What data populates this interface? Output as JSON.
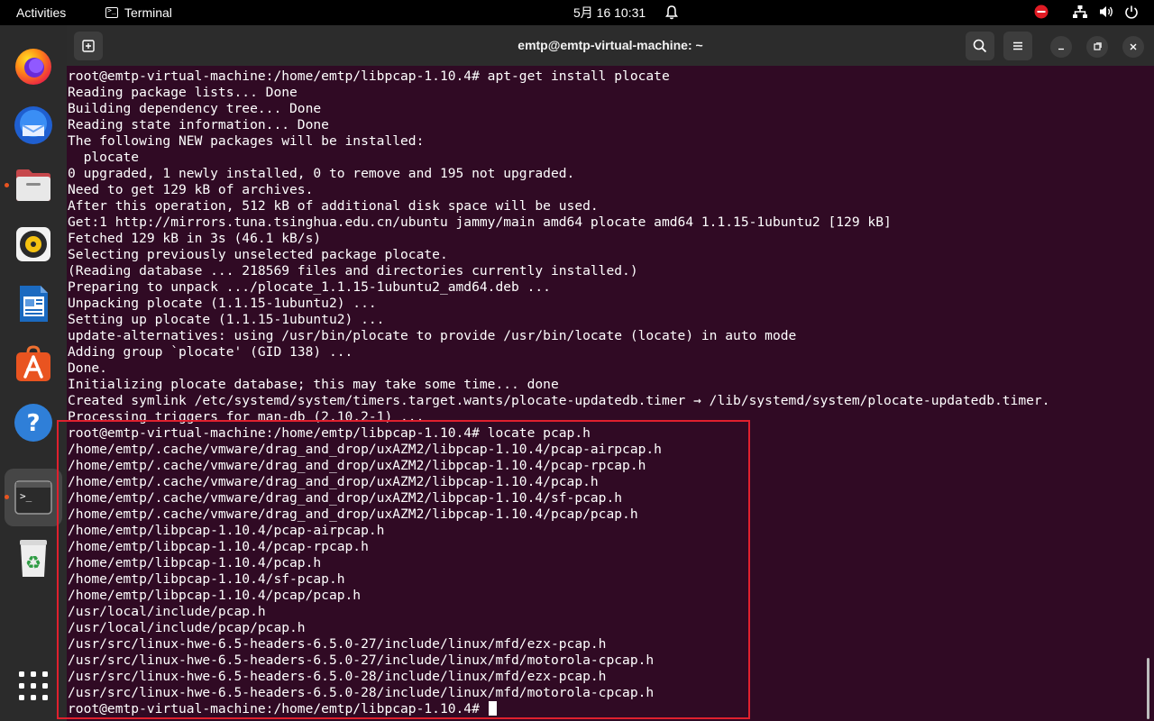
{
  "topbar": {
    "activities": "Activities",
    "app_name": "Terminal",
    "clock": "5月 16  10:31"
  },
  "dock": {
    "apps": [
      {
        "name": "Firefox",
        "icon": "firefox-icon"
      },
      {
        "name": "Thunderbird",
        "icon": "thunderbird-icon"
      },
      {
        "name": "Files",
        "icon": "files-icon"
      },
      {
        "name": "Rhythmbox",
        "icon": "rhythmbox-icon"
      },
      {
        "name": "LibreOffice Writer",
        "icon": "writer-icon"
      },
      {
        "name": "Ubuntu Software",
        "icon": "software-icon"
      },
      {
        "name": "Help",
        "icon": "help-icon"
      },
      {
        "name": "Terminal",
        "icon": "terminal-icon"
      },
      {
        "name": "Trash",
        "icon": "trash-icon"
      },
      {
        "name": "Show Applications",
        "icon": "app-grid-icon"
      }
    ]
  },
  "window": {
    "title": "emtp@emtp-virtual-machine: ~"
  },
  "colors": {
    "terminal_bg": "#300a24",
    "highlight": "#e0202e",
    "accent": "#e95420"
  },
  "terminal": {
    "lines": [
      "root@emtp-virtual-machine:/home/emtp/libpcap-1.10.4# apt-get install plocate",
      "Reading package lists... Done",
      "Building dependency tree... Done",
      "Reading state information... Done",
      "The following NEW packages will be installed:",
      "  plocate",
      "0 upgraded, 1 newly installed, 0 to remove and 195 not upgraded.",
      "Need to get 129 kB of archives.",
      "After this operation, 512 kB of additional disk space will be used.",
      "Get:1 http://mirrors.tuna.tsinghua.edu.cn/ubuntu jammy/main amd64 plocate amd64 1.1.15-1ubuntu2 [129 kB]",
      "Fetched 129 kB in 3s (46.1 kB/s)",
      "Selecting previously unselected package plocate.",
      "(Reading database ... 218569 files and directories currently installed.)",
      "Preparing to unpack .../plocate_1.1.15-1ubuntu2_amd64.deb ...",
      "Unpacking plocate (1.1.15-1ubuntu2) ...",
      "Setting up plocate (1.1.15-1ubuntu2) ...",
      "update-alternatives: using /usr/bin/plocate to provide /usr/bin/locate (locate) in auto mode",
      "Adding group `plocate' (GID 138) ...",
      "Done.",
      "Initializing plocate database; this may take some time... done",
      "Created symlink /etc/systemd/system/timers.target.wants/plocate-updatedb.timer → /lib/systemd/system/plocate-updatedb.timer.",
      "Processing triggers for man-db (2.10.2-1) ...",
      "root@emtp-virtual-machine:/home/emtp/libpcap-1.10.4# locate pcap.h",
      "/home/emtp/.cache/vmware/drag_and_drop/uxAZM2/libpcap-1.10.4/pcap-airpcap.h",
      "/home/emtp/.cache/vmware/drag_and_drop/uxAZM2/libpcap-1.10.4/pcap-rpcap.h",
      "/home/emtp/.cache/vmware/drag_and_drop/uxAZM2/libpcap-1.10.4/pcap.h",
      "/home/emtp/.cache/vmware/drag_and_drop/uxAZM2/libpcap-1.10.4/sf-pcap.h",
      "/home/emtp/.cache/vmware/drag_and_drop/uxAZM2/libpcap-1.10.4/pcap/pcap.h",
      "/home/emtp/libpcap-1.10.4/pcap-airpcap.h",
      "/home/emtp/libpcap-1.10.4/pcap-rpcap.h",
      "/home/emtp/libpcap-1.10.4/pcap.h",
      "/home/emtp/libpcap-1.10.4/sf-pcap.h",
      "/home/emtp/libpcap-1.10.4/pcap/pcap.h",
      "/usr/local/include/pcap.h",
      "/usr/local/include/pcap/pcap.h",
      "/usr/src/linux-hwe-6.5-headers-6.5.0-27/include/linux/mfd/ezx-pcap.h",
      "/usr/src/linux-hwe-6.5-headers-6.5.0-27/include/linux/mfd/motorola-cpcap.h",
      "/usr/src/linux-hwe-6.5-headers-6.5.0-28/include/linux/mfd/ezx-pcap.h",
      "/usr/src/linux-hwe-6.5-headers-6.5.0-28/include/linux/mfd/motorola-cpcap.h"
    ],
    "prompt": "root@emtp-virtual-machine:/home/emtp/libpcap-1.10.4# "
  }
}
